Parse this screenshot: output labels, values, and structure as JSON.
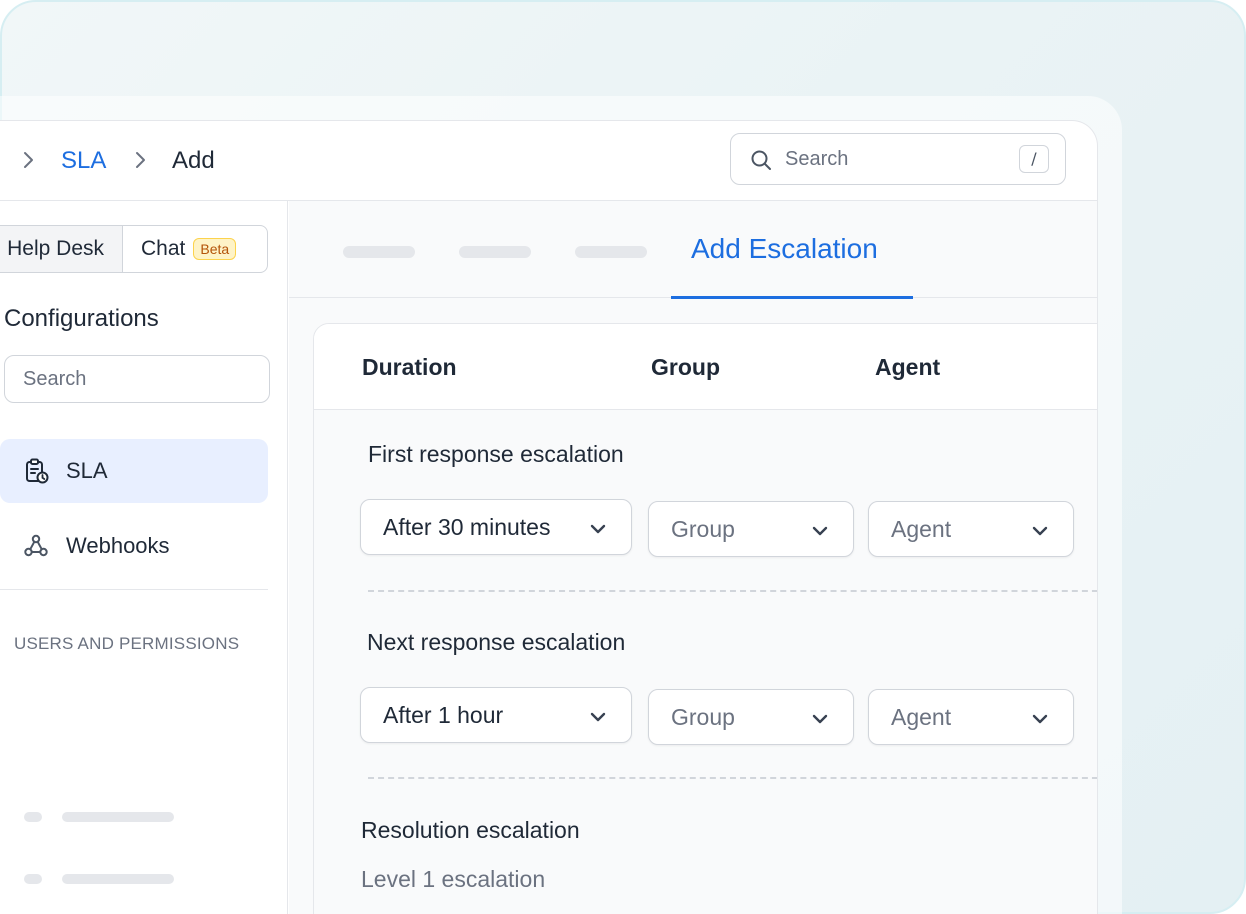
{
  "breadcrumb": {
    "sla": "SLA",
    "add": "Add"
  },
  "top_search": {
    "placeholder": "Search",
    "shortcut": "/"
  },
  "sidebar": {
    "segments": {
      "helpdesk": "Help Desk",
      "chat": "Chat",
      "chat_badge": "Beta"
    },
    "title": "Configurations",
    "search_placeholder": "Search",
    "items": [
      {
        "label": "SLA",
        "icon": "clipboard-clock-icon",
        "active": true
      },
      {
        "label": "Webhooks",
        "icon": "webhook-icon",
        "active": false
      }
    ],
    "section_heading": "USERS AND PERMISSIONS"
  },
  "tabs": {
    "active_label": "Add Escalation"
  },
  "table": {
    "columns": {
      "duration": "Duration",
      "group": "Group",
      "agent": "Agent"
    },
    "rows": [
      {
        "label": "First response escalation",
        "duration": "After 30 minutes",
        "group": "Group",
        "agent": "Agent"
      },
      {
        "label": "Next response escalation",
        "duration": "After 1 hour",
        "group": "Group",
        "agent": "Agent"
      }
    ],
    "resolution": {
      "label": "Resolution escalation",
      "level": "Level 1 escalation"
    }
  },
  "colors": {
    "accent": "#1d6ee0",
    "active_nav_bg": "#e8efff",
    "badge_text": "#b45309",
    "badge_bg": "#fef3c7"
  }
}
